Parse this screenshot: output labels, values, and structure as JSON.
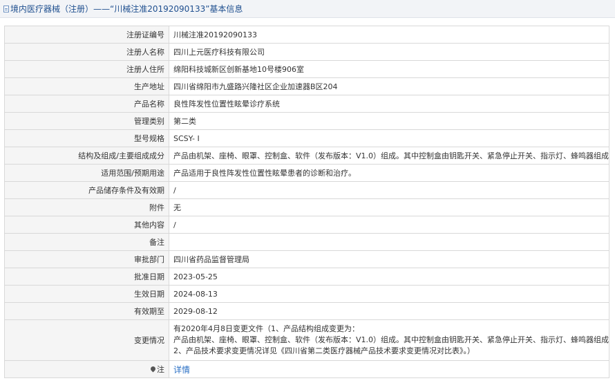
{
  "header": {
    "prefix": "境内医疗器械（注册）——",
    "title": "“川械注准20192090133”基本信息"
  },
  "rows": [
    {
      "label": "注册证编号",
      "value": "川械注准20192090133"
    },
    {
      "label": "注册人名称",
      "value": "四川上元医疗科技有限公司"
    },
    {
      "label": "注册人住所",
      "value": "绵阳科技城新区创新基地10号楼906室"
    },
    {
      "label": "生产地址",
      "value": "四川省绵阳市九盛路兴隆社区企业加速器B区204"
    },
    {
      "label": "产品名称",
      "value": "良性阵发性位置性眩晕诊疗系统"
    },
    {
      "label": "管理类别",
      "value": "第二类"
    },
    {
      "label": "型号规格",
      "value": "SCSY- I"
    },
    {
      "label": "结构及组成/主要组成成分",
      "value": "产品由机架、座椅、眼罩、控制盒、软件（发布版本：V1.0）组成。其中控制盒由钥匙开关、紧急停止开关、指示灯、蜂鸣器组成。"
    },
    {
      "label": "适用范围/预期用途",
      "value": "产品适用于良性阵发性位置性眩晕患者的诊断和治疗。"
    },
    {
      "label": "产品储存条件及有效期",
      "value": "/"
    },
    {
      "label": "附件",
      "value": "无"
    },
    {
      "label": "其他内容",
      "value": "/"
    },
    {
      "label": "备注",
      "value": ""
    },
    {
      "label": "审批部门",
      "value": "四川省药品监督管理局"
    },
    {
      "label": "批准日期",
      "value": "2023-05-25"
    },
    {
      "label": "生效日期",
      "value": "2024-08-13"
    },
    {
      "label": "有效期至",
      "value": "2029-08-12"
    }
  ],
  "change": {
    "label": "变更情况",
    "line1": "有2020年4月8日变更文件（1、产品结构组成变更为：",
    "line2": "产品由机架、座椅、眼罩、控制盒、软件（发布版本：V1.0）组成。其中控制盒由钥匙开关、紧急停止开关、指示灯、蜂鸣器组成。",
    "line3": "2、产品技术要求变更情况详见《四川省第二类医疗器械产品技术要求变更情况对比表》。）"
  },
  "note": {
    "label": "注",
    "link": "详情",
    "icon": "pin-icon"
  }
}
